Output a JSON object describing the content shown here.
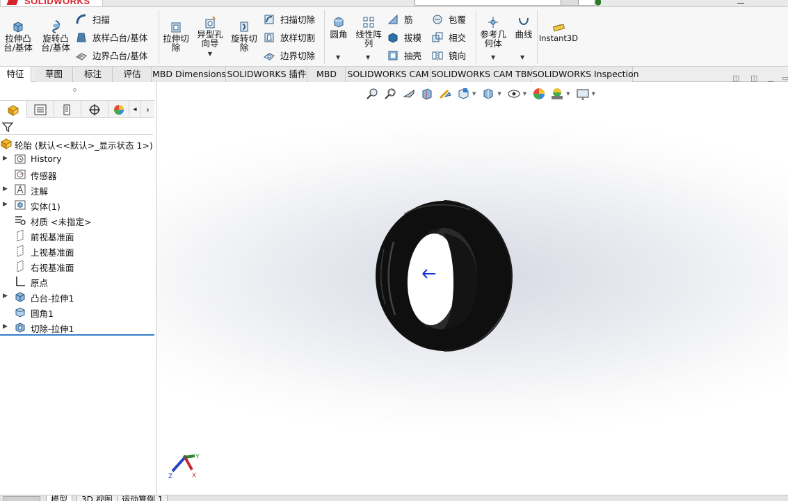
{
  "app": {
    "logo_text": "SOLIDWORKS"
  },
  "ribbon": {
    "extrude_boss": "拉伸凸\n台/基体",
    "revolve_boss": "旋转凸\n台/基体",
    "sweep": "扫描",
    "loft_boss": "放样凸台/基体",
    "boundary_boss": "边界凸台/基体",
    "extrude_cut": "拉伸切\n除",
    "hole_wizard": "异型孔\n向导",
    "revolve_cut": "旋转切\n除",
    "swept_cut": "扫描切除",
    "lofted_cut": "放样切割",
    "boundary_cut": "边界切除",
    "fillet": "圆角",
    "linear_pattern": "线性阵\n列",
    "rib": "筋",
    "draft": "拔模",
    "shell": "抽壳",
    "wrap": "包覆",
    "intersect": "相交",
    "mirror": "镜向",
    "ref_geometry": "参考几\n何体",
    "curves": "曲线",
    "instant3d": "Instant3D"
  },
  "tabs": [
    {
      "label": "特征",
      "active": true
    },
    {
      "label": "草图"
    },
    {
      "label": "标注"
    },
    {
      "label": "评估"
    },
    {
      "label": "MBD Dimensions"
    },
    {
      "label": "SOLIDWORKS 插件"
    },
    {
      "label": "MBD"
    },
    {
      "label": "SOLIDWORKS CAM"
    },
    {
      "label": "SOLIDWORKS CAM TBM"
    },
    {
      "label": "SOLIDWORKS Inspection"
    }
  ],
  "tree": {
    "root": "轮胎  (默认<<默认>_显示状态 1>)",
    "items": [
      {
        "label": "History",
        "icon": "history-icon",
        "expandable": true
      },
      {
        "label": "传感器",
        "icon": "sensor-icon",
        "expandable": false
      },
      {
        "label": "注解",
        "icon": "annotation-icon",
        "expandable": true
      },
      {
        "label": "实体(1)",
        "icon": "solid-bodies-icon",
        "expandable": true
      },
      {
        "label": "材质 <未指定>",
        "icon": "material-icon",
        "expandable": false
      },
      {
        "label": "前视基准面",
        "icon": "plane-icon",
        "expandable": false
      },
      {
        "label": "上视基准面",
        "icon": "plane-icon",
        "expandable": false
      },
      {
        "label": "右视基准面",
        "icon": "plane-icon",
        "expandable": false
      },
      {
        "label": "原点",
        "icon": "origin-icon",
        "expandable": false
      },
      {
        "label": "凸台-拉伸1",
        "icon": "extrude-feature-icon",
        "expandable": true
      },
      {
        "label": "圆角1",
        "icon": "fillet-feature-icon",
        "expandable": false
      },
      {
        "label": "切除-拉伸1",
        "icon": "cut-feature-icon",
        "expandable": true
      }
    ]
  },
  "triad": {
    "x": "X",
    "y": "Y",
    "z": "Z"
  },
  "bottom_tabs": [
    {
      "label": "模型",
      "active": true
    },
    {
      "label": "3D 视图"
    },
    {
      "label": "运动算例 1"
    }
  ],
  "colors": {
    "accent_blue": "#2f7ec7",
    "logo_red": "#d9232a",
    "tire": "#101010"
  }
}
